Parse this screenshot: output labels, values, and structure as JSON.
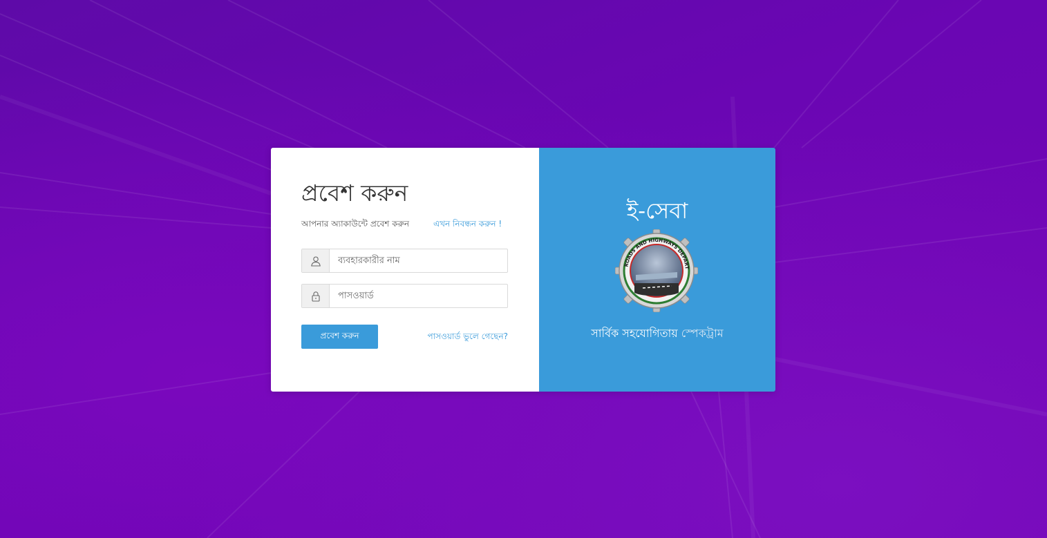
{
  "login": {
    "title": "প্রবেশ করুন",
    "subtitle": "আপনার অ্যাকাউন্টে প্রবেশ করুন",
    "register_link": "এখন নিবন্ধন করুন !",
    "username_placeholder": "ব্যবহারকারীর নাম",
    "username_icon": "user-icon",
    "password_placeholder": "পাসওয়ার্ড",
    "password_icon": "lock-icon",
    "login_button": "প্রবেশ করুন",
    "forgot_password_link": "পাসওয়ার্ড ভুলে গেছেন?"
  },
  "brand_panel": {
    "title": "ই-সেবা",
    "support_text": "সার্বিক সহযোগিতায়",
    "partner_name": "স্পেকট্রাম",
    "logo_text": "ROADS AND HIGHWAYS DEPARTMENT"
  },
  "colors": {
    "background": "#6a06b3",
    "accent": "#3a9bda",
    "card": "#ffffff"
  }
}
